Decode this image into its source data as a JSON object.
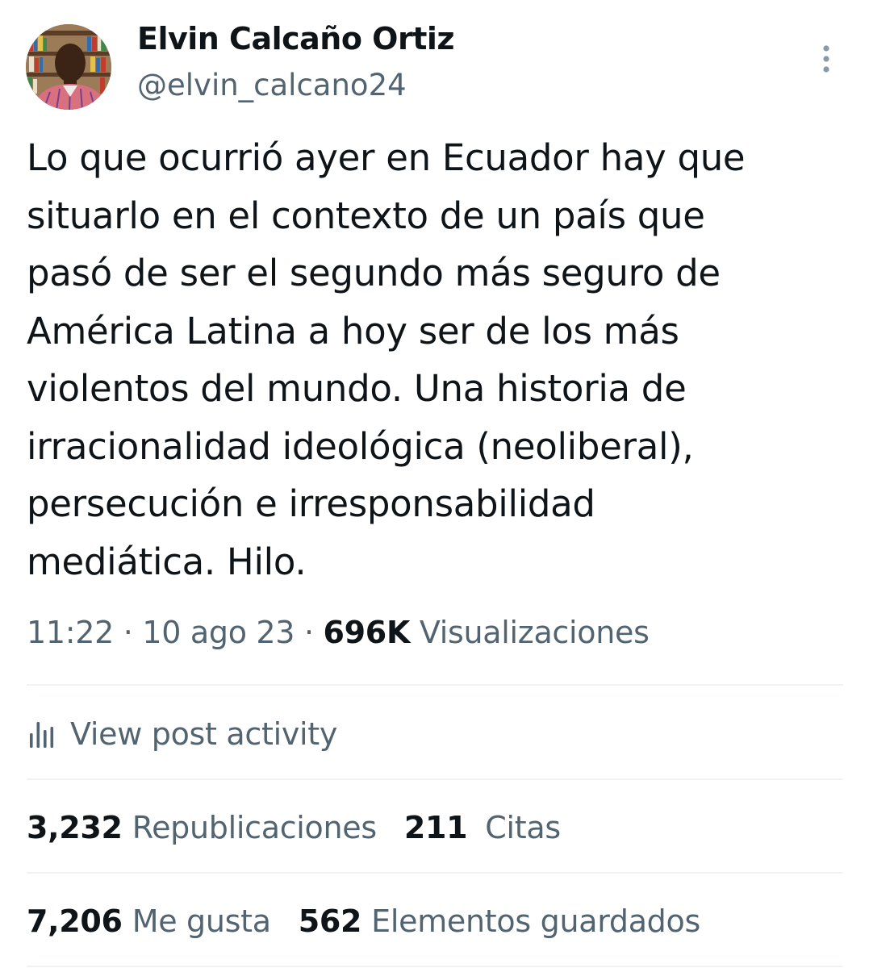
{
  "author": {
    "display_name": "Elvin Calcaño Ortiz",
    "handle": "@elvin_calcano24"
  },
  "tweet": {
    "text": "Lo que ocurrió ayer en Ecuador hay que\nsituarlo en el contexto de un país que\npasó de ser el segundo más seguro de\nAmérica Latina a hoy ser de los más\nviolentos del mundo. Una historia de\nirracionalidad ideológica (neoliberal),\npersecución e irresponsabilidad\nmediática. Hilo."
  },
  "meta": {
    "time": "11:22",
    "separator": "·",
    "date": "10 ago 23",
    "views_count": "696K",
    "views_label": "Visualizaciones"
  },
  "activity": {
    "label": "View post activity",
    "icon": "bar-chart-icon"
  },
  "stats": {
    "reposts_count": "3,232",
    "reposts_label": "Republicaciones",
    "quotes_count": "211",
    "quotes_label": "Citas",
    "likes_count": "7,206",
    "likes_label": "Me gusta",
    "bookmarks_count": "562",
    "bookmarks_label": "Elementos guardados"
  },
  "colors": {
    "text_primary": "#0f1419",
    "text_secondary": "#536471",
    "divider": "#eff3f4"
  },
  "icons": [
    "avatar-photo",
    "more-vertical-icon",
    "bar-chart-icon"
  ]
}
